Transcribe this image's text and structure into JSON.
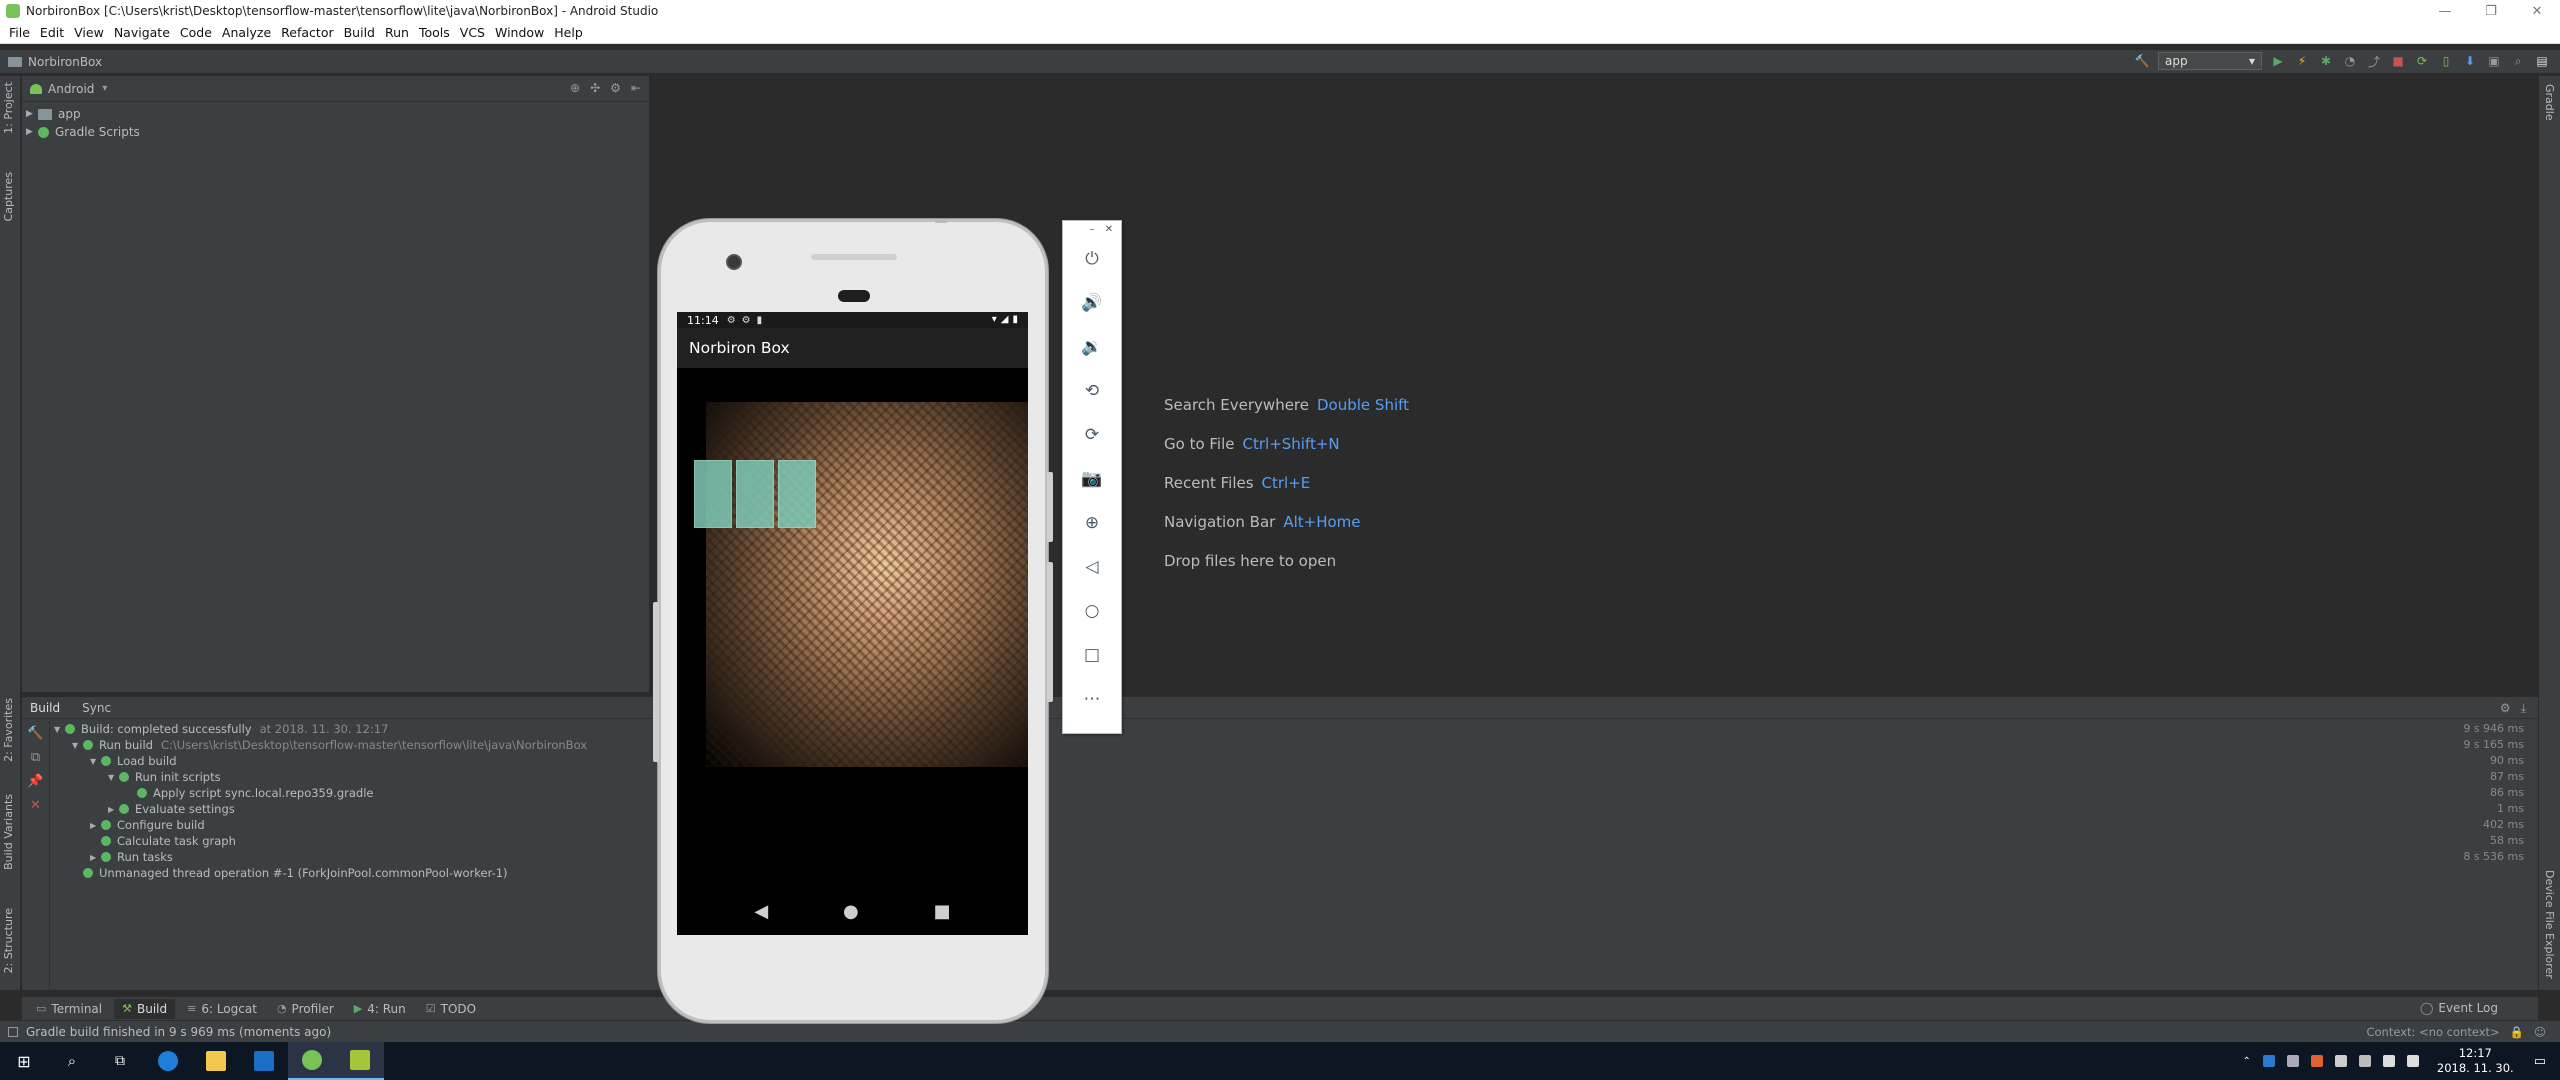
{
  "window": {
    "title": "NorbironBox [C:\\Users\\krist\\Desktop\\tensorflow-master\\tensorflow\\lite\\java\\NorbironBox] - Android Studio",
    "controls": [
      "—",
      "❐",
      "✕"
    ]
  },
  "menu": [
    "File",
    "Edit",
    "View",
    "Navigate",
    "Code",
    "Analyze",
    "Refactor",
    "Build",
    "Run",
    "Tools",
    "VCS",
    "Window",
    "Help"
  ],
  "nav": {
    "project": "NorbironBox",
    "run_config": "app"
  },
  "left_strip": {
    "project": "1: Project",
    "captures": "Captures",
    "favorites": "2: Favorites",
    "build_variants": "Build Variants",
    "structure": "2: Structure"
  },
  "right_strip": {
    "gradle": "Gradle",
    "device_explorer": "Device File Explorer"
  },
  "project_panel": {
    "view_mode": "Android",
    "items": [
      {
        "label": "app"
      },
      {
        "label": "Gradle Scripts"
      }
    ]
  },
  "editor": {
    "hints": [
      {
        "label": "Search Everywhere",
        "key": "Double Shift"
      },
      {
        "label": "Go to File",
        "key": "Ctrl+Shift+N"
      },
      {
        "label": "Recent Files",
        "key": "Ctrl+E"
      },
      {
        "label": "Navigation Bar",
        "key": "Alt+Home"
      },
      {
        "label": "Drop files here to open",
        "key": ""
      }
    ]
  },
  "phone": {
    "time": "11:14",
    "app_title": "Norbiron Box"
  },
  "build": {
    "tabs": [
      "Build",
      "Sync"
    ],
    "rows": [
      {
        "label": "Build: completed successfully",
        "extra": "at 2018. 11. 30. 12:17",
        "time": "9 s 946 ms"
      },
      {
        "label": "Run build",
        "extra": "C:\\Users\\krist\\Desktop\\tensorflow-master\\tensorflow\\lite\\java\\NorbironBox",
        "time": "9 s 165 ms"
      },
      {
        "label": "Load build",
        "extra": "",
        "time": "90 ms"
      },
      {
        "label": "Run init scripts",
        "extra": "",
        "time": "87 ms"
      },
      {
        "label": "Apply script sync.local.repo359.gradle",
        "extra": "",
        "time": "86 ms"
      },
      {
        "label": "Evaluate settings",
        "extra": "",
        "time": "1 ms"
      },
      {
        "label": "Configure build",
        "extra": "",
        "time": "402 ms"
      },
      {
        "label": "Calculate task graph",
        "extra": "",
        "time": "58 ms"
      },
      {
        "label": "Run tasks",
        "extra": "",
        "time": "8 s 536 ms"
      },
      {
        "label": "Unmanaged thread operation #-1 (ForkJoinPool.commonPool-worker-1)",
        "extra": "",
        "time": ""
      }
    ]
  },
  "bottom_tabs": [
    {
      "label": "Terminal"
    },
    {
      "label": "Build"
    },
    {
      "label": "6: Logcat"
    },
    {
      "label": "Profiler"
    },
    {
      "label": "4: Run"
    },
    {
      "label": "TODO"
    }
  ],
  "event_log": "Event Log",
  "status": {
    "message": "Gradle build finished in 9 s 969 ms (moments ago)",
    "context": "Context: <no context>"
  },
  "taskbar": {
    "time": "12:17",
    "date": "2018. 11. 30."
  },
  "colors": {
    "accent": "#589df6",
    "ok": "#5fb760",
    "android": "#78c257"
  }
}
